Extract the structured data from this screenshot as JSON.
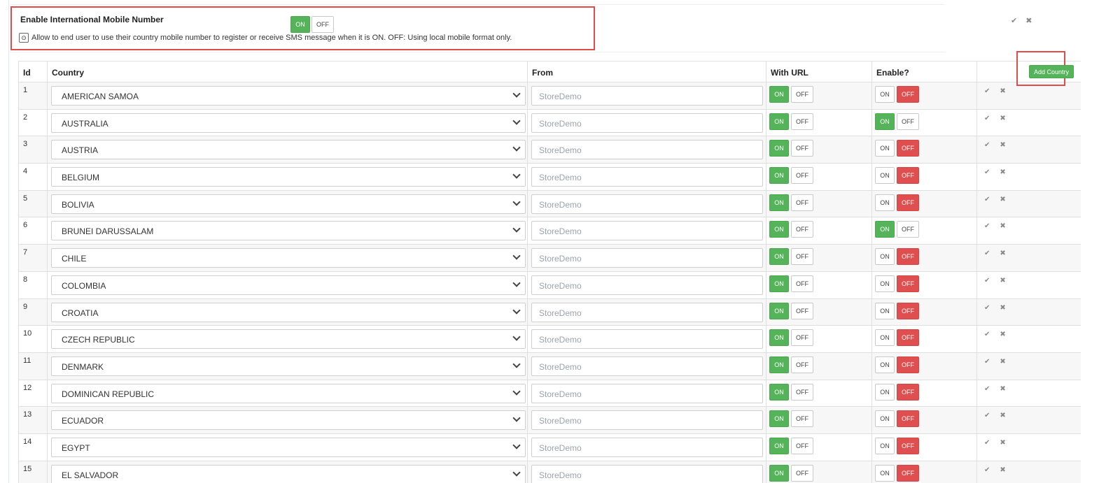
{
  "settings": {
    "title": "Enable International Mobile Number",
    "toggle": {
      "on_label": "ON",
      "off_label": "OFF",
      "state": "on"
    },
    "description": "Allow to end user to use their country mobile number to register or receive SMS message when it is ON. OFF: Using local mobile format only."
  },
  "top_actions": {
    "confirm": "✔",
    "cancel": "✖"
  },
  "table": {
    "headers": {
      "id": "Id",
      "country": "Country",
      "from": "From",
      "with_url": "With URL",
      "enable": "Enable?"
    },
    "add_country_label": "Add Country",
    "from_placeholder": "StoreDemo",
    "toggle_on": "ON",
    "toggle_off": "OFF",
    "action_confirm": "✔",
    "action_cancel": "✖",
    "rows": [
      {
        "id": "1",
        "country": "AMERICAN SAMOA",
        "with_url": "on",
        "enable": "off"
      },
      {
        "id": "2",
        "country": "AUSTRALIA",
        "with_url": "on",
        "enable": "on"
      },
      {
        "id": "3",
        "country": "AUSTRIA",
        "with_url": "on",
        "enable": "off"
      },
      {
        "id": "4",
        "country": "BELGIUM",
        "with_url": "on",
        "enable": "off"
      },
      {
        "id": "5",
        "country": "BOLIVIA",
        "with_url": "on",
        "enable": "off"
      },
      {
        "id": "6",
        "country": "BRUNEI DARUSSALAM",
        "with_url": "on",
        "enable": "on"
      },
      {
        "id": "7",
        "country": "CHILE",
        "with_url": "on",
        "enable": "off"
      },
      {
        "id": "8",
        "country": "COLOMBIA",
        "with_url": "on",
        "enable": "off"
      },
      {
        "id": "9",
        "country": "CROATIA",
        "with_url": "on",
        "enable": "off"
      },
      {
        "id": "10",
        "country": "CZECH REPUBLIC",
        "with_url": "on",
        "enable": "off"
      },
      {
        "id": "11",
        "country": "DENMARK",
        "with_url": "on",
        "enable": "off"
      },
      {
        "id": "12",
        "country": "DOMINICAN REPUBLIC",
        "with_url": "on",
        "enable": "off"
      },
      {
        "id": "13",
        "country": "ECUADOR",
        "with_url": "on",
        "enable": "off"
      },
      {
        "id": "14",
        "country": "EGYPT",
        "with_url": "on",
        "enable": "off"
      },
      {
        "id": "15",
        "country": "EL SALVADOR",
        "with_url": "on",
        "enable": "off"
      }
    ]
  },
  "colors": {
    "on": "#55b35a",
    "off": "#df4f4f",
    "highlight": "#e04b4b"
  }
}
